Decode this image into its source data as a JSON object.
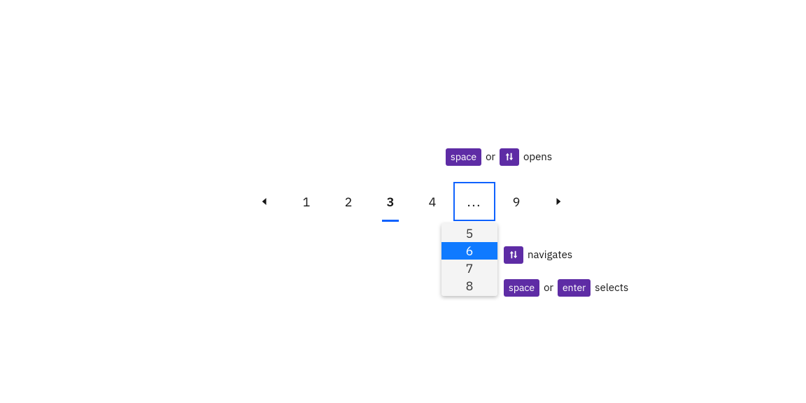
{
  "pagination": {
    "prev_icon": "caret-left",
    "next_icon": "caret-right",
    "pages": [
      "1",
      "2",
      "3",
      "4",
      "...",
      "9"
    ],
    "current": "3",
    "overflow_label": "...",
    "overflow_options": [
      "5",
      "6",
      "7",
      "8"
    ],
    "overflow_highlighted": "6"
  },
  "hints": {
    "open": {
      "key1": "space",
      "or": "or",
      "key2_icon": "up-down-arrows",
      "verb": "opens"
    },
    "navigate": {
      "key_icon": "up-down-arrows",
      "verb": "navigates"
    },
    "select": {
      "key1": "space",
      "or": "or",
      "key2": "enter",
      "verb": "selects"
    }
  }
}
